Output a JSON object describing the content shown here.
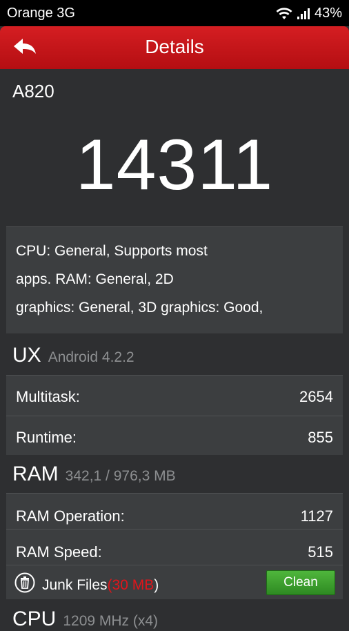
{
  "status_bar": {
    "carrier": "Orange 3G",
    "battery": "43%"
  },
  "app_bar": {
    "title": "Details",
    "back_icon": "back-arrow-icon"
  },
  "device": {
    "model": "A820",
    "score": "14311"
  },
  "description": {
    "lines": [
      "CPU: General, Supports most",
      "apps. RAM: General, 2D",
      "graphics: General, 3D graphics: Good,"
    ]
  },
  "ux": {
    "name": "UX",
    "subtitle": "Android 4.2.2",
    "rows": [
      {
        "label": "Multitask:",
        "value": "2654"
      },
      {
        "label": "Runtime:",
        "value": "855"
      }
    ]
  },
  "ram": {
    "name": "RAM",
    "subtitle": "342,1 / 976,3 MB",
    "rows": [
      {
        "label": "RAM Operation:",
        "value": "1127"
      },
      {
        "label": "RAM Speed:",
        "value": "515"
      }
    ]
  },
  "junk": {
    "label": "Junk Files",
    "open_paren": "(",
    "amount": "30 MB",
    "close_paren": ")",
    "clean_label": "Clean",
    "icon": "trash-icon"
  },
  "cpu": {
    "name": "CPU",
    "subtitle": "1209 MHz (x4)"
  },
  "colors": {
    "appbar_red": "#c8161a",
    "background": "#2e2f31",
    "card": "#3c3e40",
    "clean_green": "#3fa32f",
    "junk_amount_red": "#e0151b"
  }
}
